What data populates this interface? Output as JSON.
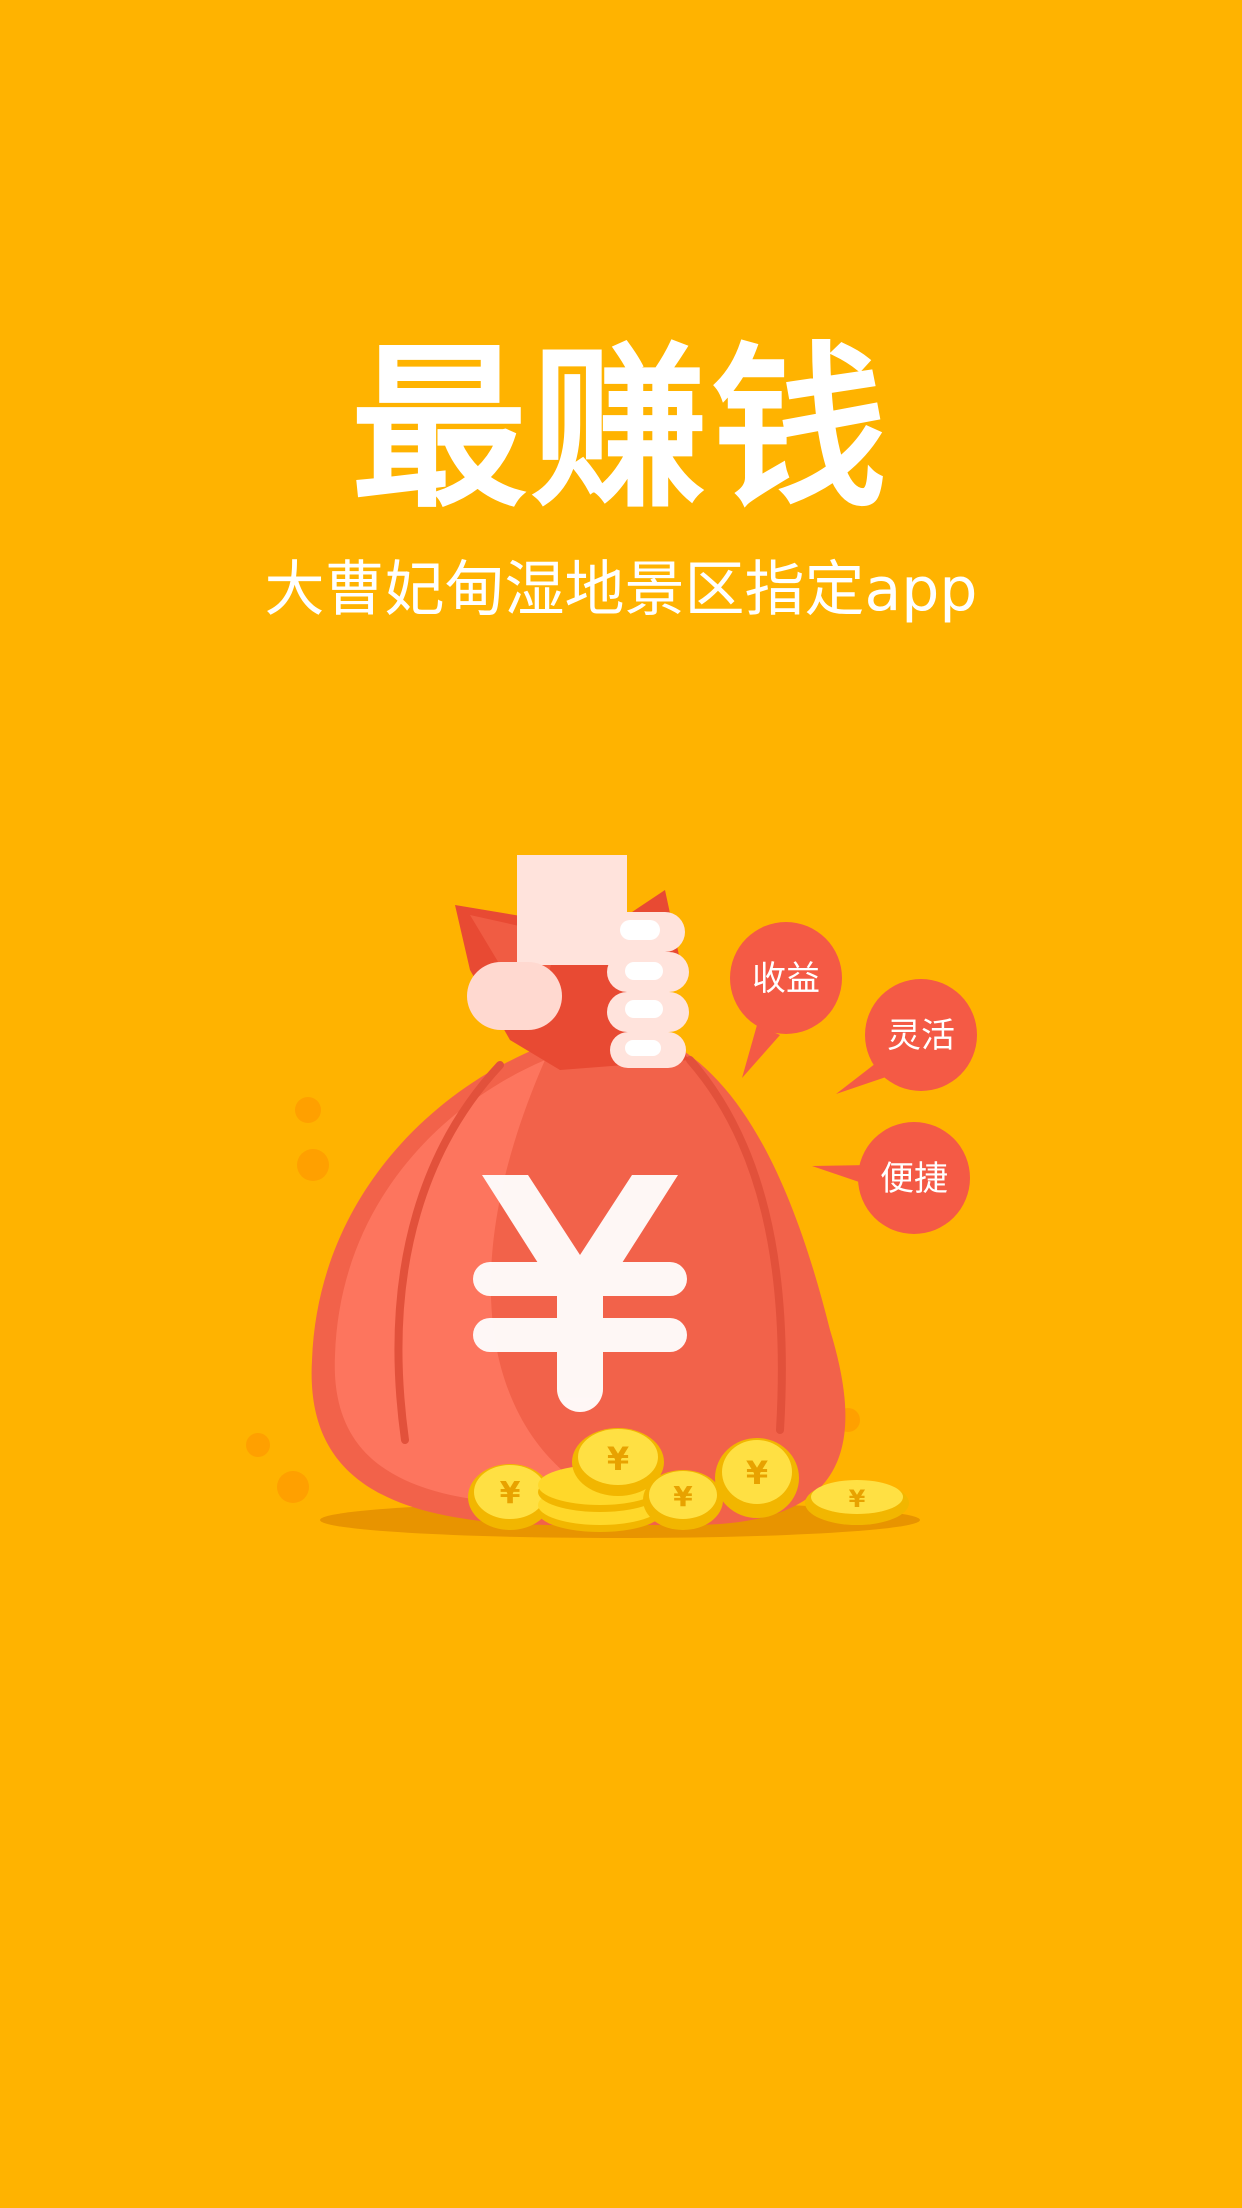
{
  "splash": {
    "headline": "最赚钱",
    "subtitle": "大曹妃甸湿地景区指定app",
    "background_color": "#FFB300"
  },
  "illustration": {
    "bag_symbol": "¥",
    "bubbles": [
      "收益",
      "灵活",
      "便捷"
    ],
    "icons": [
      "money-bag-icon",
      "hand-icon",
      "coin-icon"
    ]
  }
}
